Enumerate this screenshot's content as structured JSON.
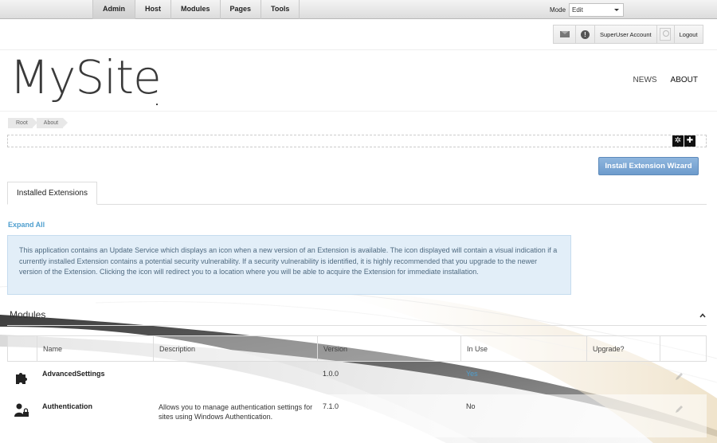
{
  "controlbar": {
    "menu": [
      "Admin",
      "Host",
      "Modules",
      "Pages",
      "Tools"
    ],
    "mode_label": "Mode",
    "mode_value": "Edit"
  },
  "userbar": {
    "account": "SuperUser Account",
    "logout": "Logout"
  },
  "header": {
    "logo": "MySite",
    "nav": [
      "NEWS",
      "ABOUT"
    ]
  },
  "breadcrumb": [
    "Root",
    "About"
  ],
  "toolbar": {
    "wizard_label": "Install Extension Wizard"
  },
  "tabs": [
    "Installed Extensions"
  ],
  "expand_all": "Expand All",
  "info": "This application contains an Update Service which displays an icon when a new version of an Extension is available. The icon displayed will contain a visual indication if a currently installed Extension contains a potential security vulnerability. If a security vulnerability is identified, it is highly recommended that you upgrade to the newer version of the Extension. Clicking the icon will redirect you to a location where you will be able to acquire the Extension for immediate installation.",
  "section": {
    "title": "Modules"
  },
  "table": {
    "headers": [
      "Name",
      "Description",
      "Version",
      "In Use",
      "Upgrade?"
    ],
    "rows": [
      {
        "name": "AdvancedSettings",
        "description": "",
        "version": "1.0.0",
        "in_use": "Yes",
        "upgrade": ""
      },
      {
        "name": "Authentication",
        "description": "Allows you to manage authentication settings for sites using Windows Authentication.",
        "version": "7.1.0",
        "in_use": "No",
        "upgrade": ""
      }
    ]
  },
  "colors": {
    "accent_link": "#4f9fcf",
    "wizard_button": "#7ba6d4",
    "info_background": "#e2eef8"
  }
}
